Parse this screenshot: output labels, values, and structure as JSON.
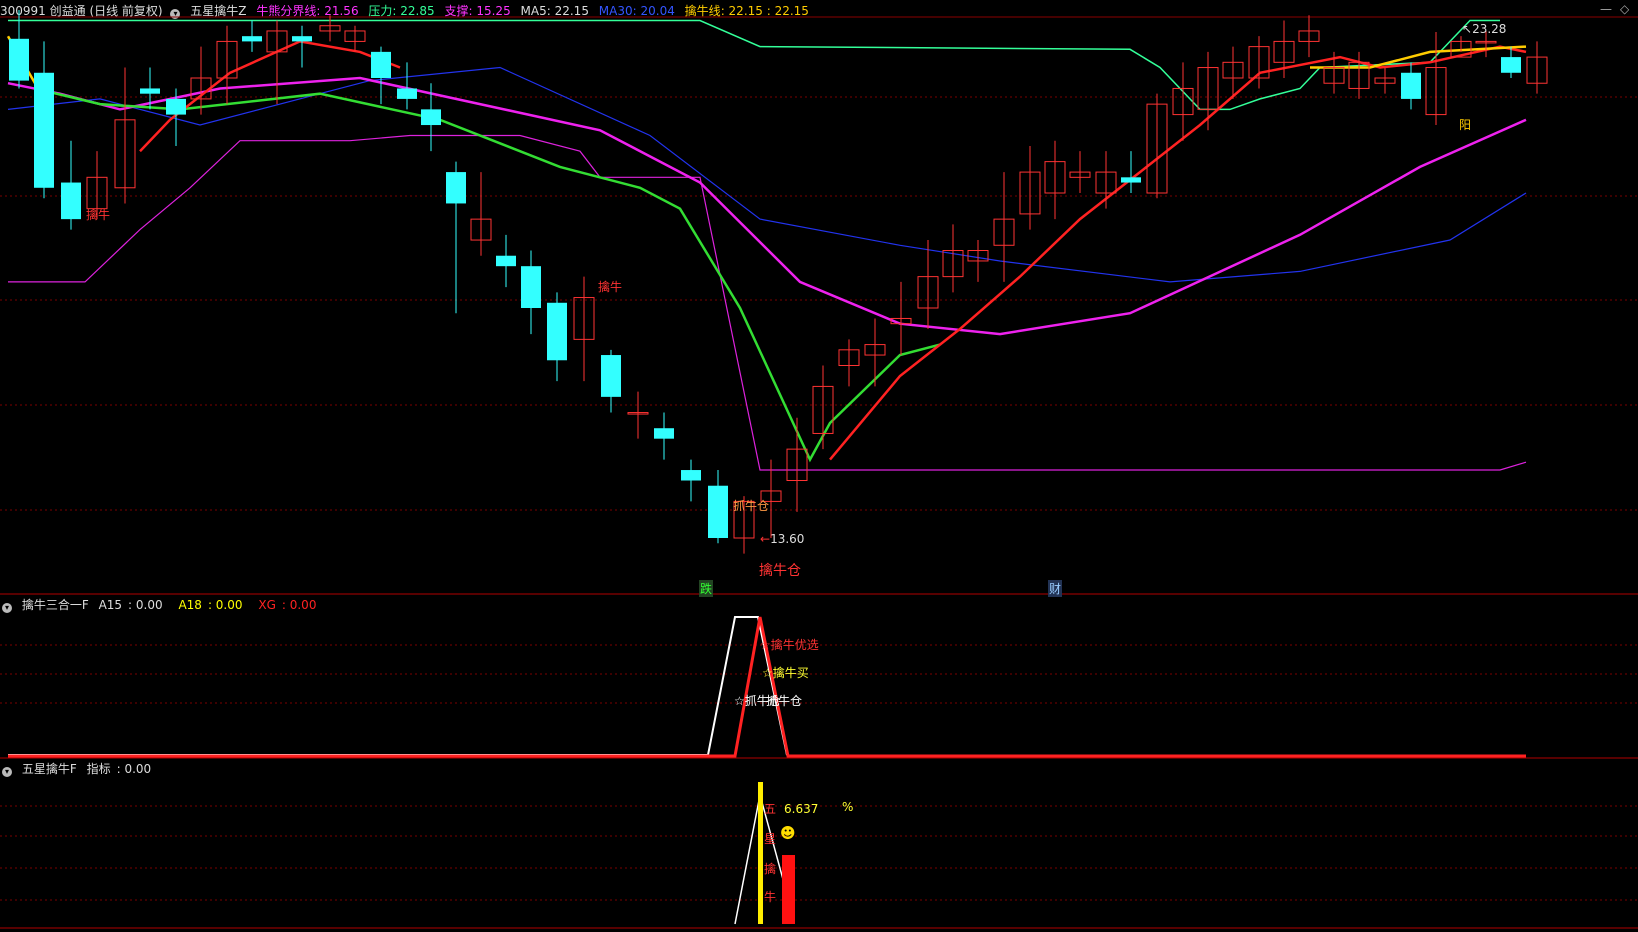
{
  "header": {
    "stock": "300991 创益通 (日线 前复权)",
    "indicator": "五星擒牛Z",
    "items": [
      {
        "label": "牛熊分界线",
        "value": "21.56",
        "color": "#ff33ff"
      },
      {
        "label": "压力",
        "value": "22.85",
        "color": "#33ff99"
      },
      {
        "label": "支撑",
        "value": "15.25",
        "color": "#ff33ff"
      },
      {
        "label": "MA5",
        "value": "22.15",
        "color": "#dddddd"
      },
      {
        "label": "MA30",
        "value": "20.04",
        "color": "#3355ff"
      },
      {
        "label": "擒牛线",
        "value": "22.15 : 22.15",
        "color": "#ffcc00"
      }
    ]
  },
  "main_labels": {
    "qn1": "擒牛",
    "qn2": "擒牛",
    "zhuaniucang": "抓牛仓",
    "low": "13.60",
    "high": "23.28",
    "yang": "阳",
    "bottom_red": "擒牛仓",
    "die": "跌",
    "cai": "财"
  },
  "panel2": {
    "title": "擒牛三合一F",
    "items": [
      {
        "label": "A15",
        "value": "0.00",
        "color": "#dddddd"
      },
      {
        "label": "A18",
        "value": "0.00",
        "color": "#ffff00"
      },
      {
        "label": "XG",
        "value": "0.00",
        "color": "#ff2222"
      }
    ],
    "signals": {
      "s1": "擒牛优选",
      "s2": "擒牛买",
      "s3": "抓牛仓",
      "s4": "抓牛仓"
    }
  },
  "panel3": {
    "title": "五星擒牛F",
    "items": [
      {
        "label": "指标",
        "value": "0.00",
        "color": "#dddddd"
      }
    ],
    "value": "6.637",
    "percent": "%",
    "vtext": [
      "五",
      "星",
      "擒",
      "牛"
    ]
  },
  "colors": {
    "up": "#ff3333",
    "down": "#33ffff",
    "bg": "#000000"
  }
}
